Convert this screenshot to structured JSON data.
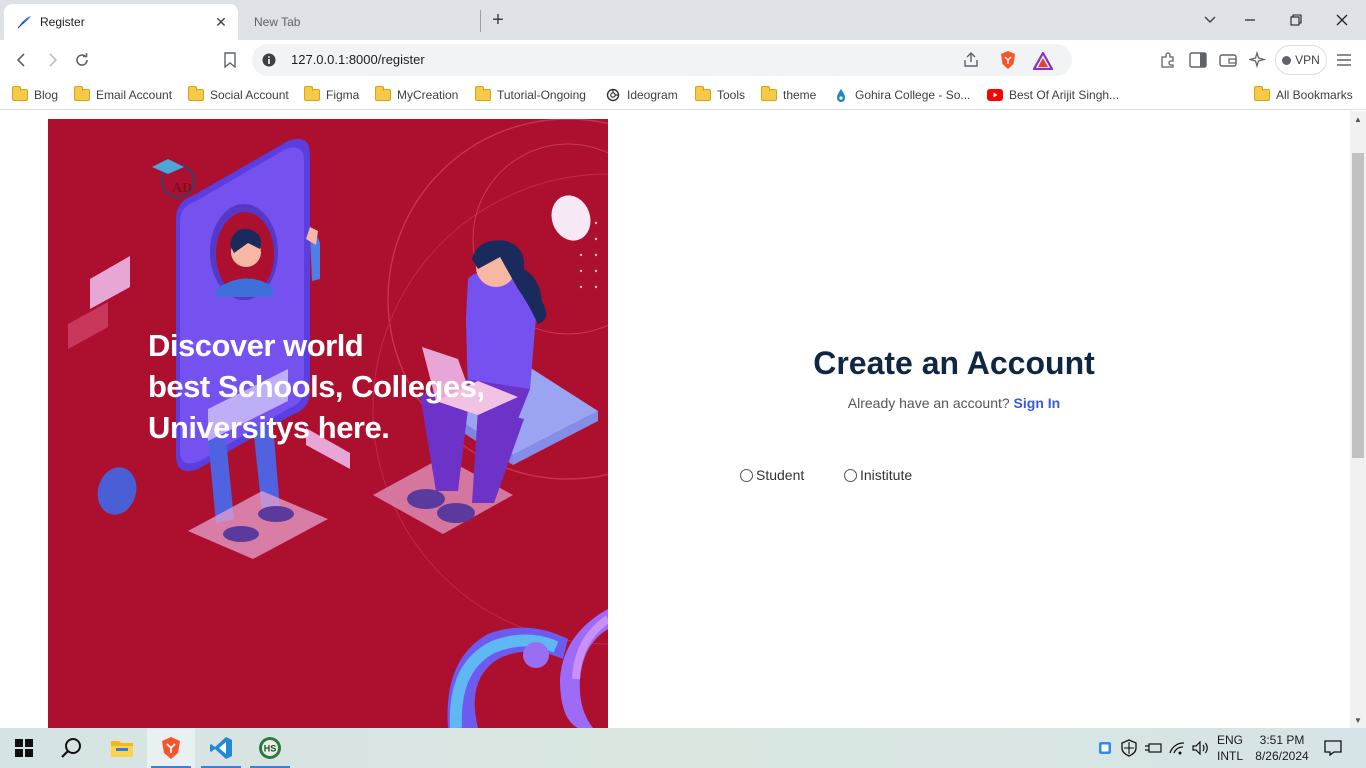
{
  "browser": {
    "tabs": [
      {
        "title": "Register",
        "active": true
      },
      {
        "title": "New Tab",
        "active": false
      }
    ],
    "url": "127.0.0.1:8000/register",
    "vpn_label": "VPN"
  },
  "bookmarks": {
    "items": [
      {
        "label": "Blog",
        "icon": "folder-icon"
      },
      {
        "label": "Email Account",
        "icon": "folder-icon"
      },
      {
        "label": "Social Account",
        "icon": "folder-icon"
      },
      {
        "label": "Figma",
        "icon": "folder-icon"
      },
      {
        "label": "MyCreation",
        "icon": "folder-icon"
      },
      {
        "label": "Tutorial-Ongoing",
        "icon": "folder-icon"
      },
      {
        "label": "Ideogram",
        "icon": "ideogram-icon"
      },
      {
        "label": "Tools",
        "icon": "folder-icon"
      },
      {
        "label": "theme",
        "icon": "folder-icon"
      },
      {
        "label": "Gohira College - So...",
        "icon": "gohira-icon"
      },
      {
        "label": "Best Of Arijit Singh...",
        "icon": "youtube-icon"
      }
    ],
    "all_bookmarks": "All Bookmarks"
  },
  "hero": {
    "headline": [
      "Discover world",
      "best Schools, Colleges,",
      "Universitys here."
    ],
    "bg_color": "#ad0f2f"
  },
  "form": {
    "title": "Create an Account",
    "subtitle": "Already have an account?",
    "signin_link": "Sign In",
    "options": [
      {
        "label": "Student",
        "checked": false
      },
      {
        "label": "Inistitute",
        "checked": false
      }
    ]
  },
  "taskbar": {
    "apps": [
      "windows-start",
      "search",
      "file-explorer",
      "brave-browser",
      "vscode",
      "hs-app"
    ],
    "lang_line1": "ENG",
    "lang_line2": "INTL",
    "time": "3:51 PM",
    "date": "8/26/2024"
  },
  "colors": {
    "accent": "#3a5bd9",
    "title": "#0f2744",
    "hero": "#ad0f2f"
  }
}
